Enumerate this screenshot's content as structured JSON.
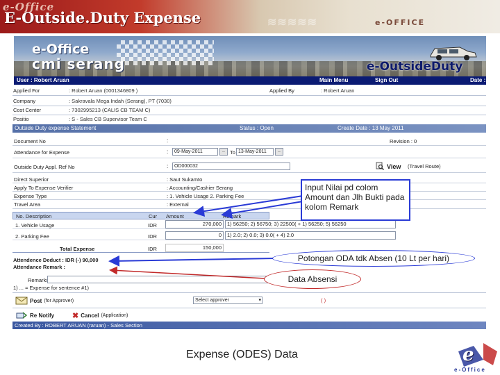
{
  "slide": {
    "brand_top": "e-Office",
    "title": "E-Outside.Duty Expense",
    "brand_right": "e-OFFICE",
    "caption": "Expense (ODES) Data"
  },
  "banner": {
    "logo_main": "e-Office",
    "logo_sub": "cmi serang",
    "module_name": "e-OutsideDuty"
  },
  "navbar": {
    "user": "User : Robert Aruan",
    "main_menu": "Main Menu",
    "sign_out": "Sign Out",
    "date_label": "Date :"
  },
  "info": {
    "applied_for_label": "Applied For",
    "applied_for_value": ": Robert Aruan (0001346809 )",
    "applied_by_label": "Applied By",
    "applied_by_value": ": Robert Aruan",
    "company_label": "Company",
    "company_value": ": Sakravala Mega Indah (Serang), PT (7030)",
    "cost_center_label": "Cost Center",
    "cost_center_value": ": 7302995213 (CALIS CB TEAM C)",
    "position_label": "Positio",
    "position_value": ": S - Sales CB Supervisor Team C"
  },
  "statement": {
    "title": "Outside Duty expense Statement",
    "status": "Status : Open",
    "create_date": "Create Date : 13 May 2011",
    "document_no_label": "Document No",
    "document_no_value": ":",
    "revision_label": "Revision : 0",
    "attendance_label": "Attendance for Expense",
    "date_from": "09-May-2011",
    "to_label": "To",
    "date_to": "13-May-2011",
    "date_btn": "..",
    "ref_label": "Outside Duty Appl. Ref No",
    "ref_value": "OD000032",
    "view_label": "View",
    "travel_route": "(Travel Route)",
    "superior_label": "Direct Superior",
    "superior_value": ": Saut Sukamto",
    "verifier_label": "Apply To Expense Verifier",
    "verifier_value": ": Accounting/Cashier Serang",
    "expense_type_label": "Expense Type",
    "expense_type_value": ": 1. Vehicle Usage   2. Parking Fee",
    "travel_area_label": "Travel Area",
    "travel_area_value": ": External"
  },
  "table": {
    "headers": [
      "No. Description",
      "Cur",
      "Amount",
      "Remark"
    ],
    "rows": [
      {
        "desc": "1.  Vehicle Usage",
        "cur": "IDR",
        "amount": "270,000",
        "remark": "1) 56250; 2) 56750; 3) 22500( + 1) 56250; 5) 56250"
      },
      {
        "desc": "2.  Parking Fee",
        "cur": "IDR",
        "amount": "0",
        "remark": "1) 2.0; 2) 0.0; 3) 0.0( + 4) 2.0"
      }
    ],
    "total_label": "Total Expense",
    "total_cur": "IDR",
    "total_amount": "150,000"
  },
  "attendance": {
    "deduct": "Attendence Deduct : IDR (-) 90,000",
    "remark_title": "Attendance Remark :",
    "remarks_label": "Remarks :",
    "expense_note": "1) ... = Expense for sentence #1)"
  },
  "actions": {
    "post": "Post",
    "post_note": "(for Approver)",
    "select_placeholder": "Select approver",
    "paren_note": "(            )",
    "re_notify": "Re Notify",
    "cancel": "Cancel",
    "cancel_note": "(Application)"
  },
  "footer": {
    "created_by": "Created By : ROBERT ARUAN (raruan) - Sales Section"
  },
  "callouts": {
    "blue_note": "Input Nilai pd colom Amount dan Jlh Bukti pada kolom Remark",
    "oda_note": "Potongan ODA tdk Absen (10 Lt per hari)",
    "absensi_note": "Data Absensi"
  },
  "corner_logo": {
    "mark": "e",
    "text": "e-Office"
  },
  "colors": {
    "nav_dark": "#0b1b73",
    "section_blue": "#5570a8",
    "callout_blue": "#2a3bd6",
    "callout_red": "#c22a2a"
  }
}
